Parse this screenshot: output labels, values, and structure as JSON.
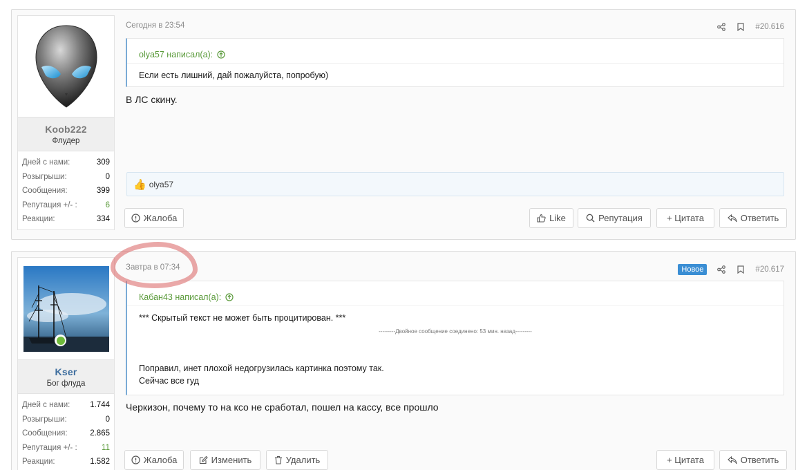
{
  "posts": [
    {
      "user": {
        "name": "Koob222",
        "title": "Флудер",
        "stats": [
          {
            "k": "Дней с нами:",
            "v": "309"
          },
          {
            "k": "Розыгрыши:",
            "v": "0"
          },
          {
            "k": "Сообщения:",
            "v": "399"
          },
          {
            "k": "Репутация +/- :",
            "v": "6"
          },
          {
            "k": "Реакции:",
            "v": "334"
          }
        ]
      },
      "time": "Сегодня в 23:54",
      "number": "#20.616",
      "quote": {
        "author": "olya57 написал(а):",
        "text": "Если есть лишний, дай пожалуйста, попробую)"
      },
      "text": "В ЛС скину.",
      "reactions": "olya57",
      "buttons": {
        "report": "Жалоба",
        "like": "Like",
        "rep": "Репутация",
        "quote": "+ Цитата",
        "reply": "Ответить"
      }
    },
    {
      "user": {
        "name": "Kser",
        "title": "Бог флуда",
        "stats": [
          {
            "k": "Дней с нами:",
            "v": "1.744"
          },
          {
            "k": "Розыгрыши:",
            "v": "0"
          },
          {
            "k": "Сообщения:",
            "v": "2.865"
          },
          {
            "k": "Репутация +/- :",
            "v": "11"
          },
          {
            "k": "Реакции:",
            "v": "1.582"
          }
        ]
      },
      "time": "Завтра в 07:34",
      "badge": "Новое",
      "number": "#20.617",
      "quote": {
        "author": "Кабан43 написал(а):",
        "text": "*** Скрытый текст не может быть процитирован. ***",
        "merged": "---------Двойное сообщение соединено: 53 мин. назад---------",
        "text2a": "Поправил, инет плохой недогрузилась картинка поэтому так.",
        "text2b": "Сейчас все гуд"
      },
      "text": "Черкизон, почему то на ксо не сработал, пошел на кассу, все прошло",
      "buttons": {
        "report": "Жалоба",
        "edit": "Изменить",
        "delete": "Удалить",
        "quote": "+ Цитата",
        "reply": "Ответить"
      }
    }
  ],
  "colors": {
    "accent": "#3a8ed4",
    "green": "#5a9a3a",
    "mark": "#dc6e6e"
  }
}
